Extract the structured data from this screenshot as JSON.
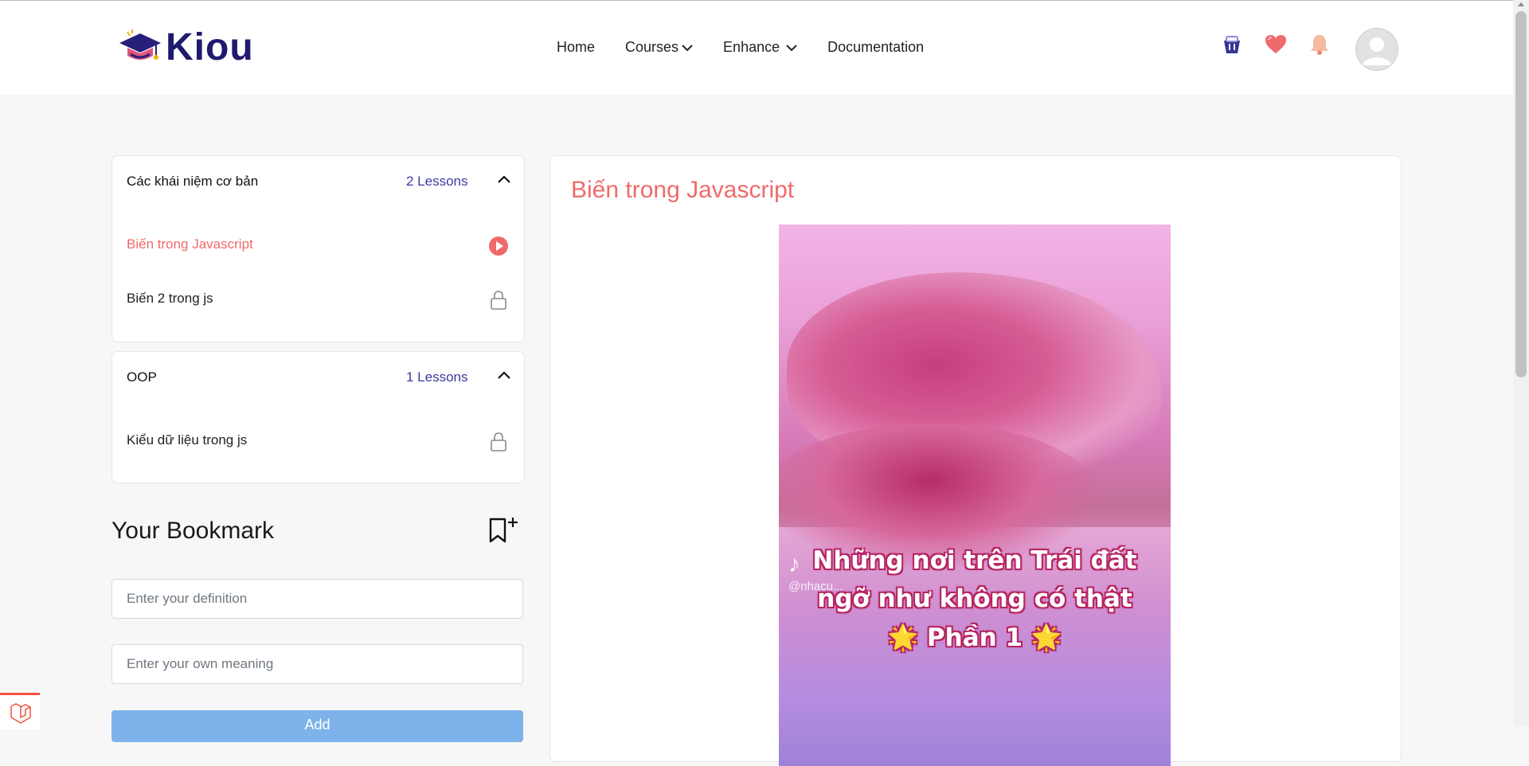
{
  "header": {
    "logo_text": "Kiou",
    "nav": [
      {
        "label": "Home",
        "has_dropdown": false
      },
      {
        "label": "Courses",
        "has_dropdown": true
      },
      {
        "label": "Enhance",
        "has_dropdown": true
      },
      {
        "label": "Documentation",
        "has_dropdown": false
      }
    ],
    "icons": [
      "cart-icon",
      "heart-icon",
      "bell-icon"
    ]
  },
  "sidebar": {
    "sections": [
      {
        "title": "Các khái niệm cơ bản",
        "count": "2 Lessons",
        "lessons": [
          {
            "title": "Biến trong Javascript",
            "status": "playing"
          },
          {
            "title": "Biến 2 trong js",
            "status": "locked"
          }
        ]
      },
      {
        "title": "OOP",
        "count": "1 Lessons",
        "lessons": [
          {
            "title": "Kiểu dữ liệu trong js",
            "status": "locked"
          }
        ]
      }
    ],
    "bookmark": {
      "title": "Your Bookmark",
      "definition_placeholder": "Enter your definition",
      "meaning_placeholder": "Enter your own meaning",
      "add_label": "Add"
    }
  },
  "main": {
    "lesson_title": "Biến trong Javascript",
    "video": {
      "caption_line1": "Những nơi trên Trái đất",
      "caption_line2": "ngỡ như không có thật",
      "caption_line3": "🌟 Phần 1 🌟",
      "watermark": "@nhacu..."
    }
  },
  "colors": {
    "accent": "#f06a6a",
    "count": "#3b3aa0",
    "logo": "#1f1a6e",
    "button": "#7db3ea"
  }
}
